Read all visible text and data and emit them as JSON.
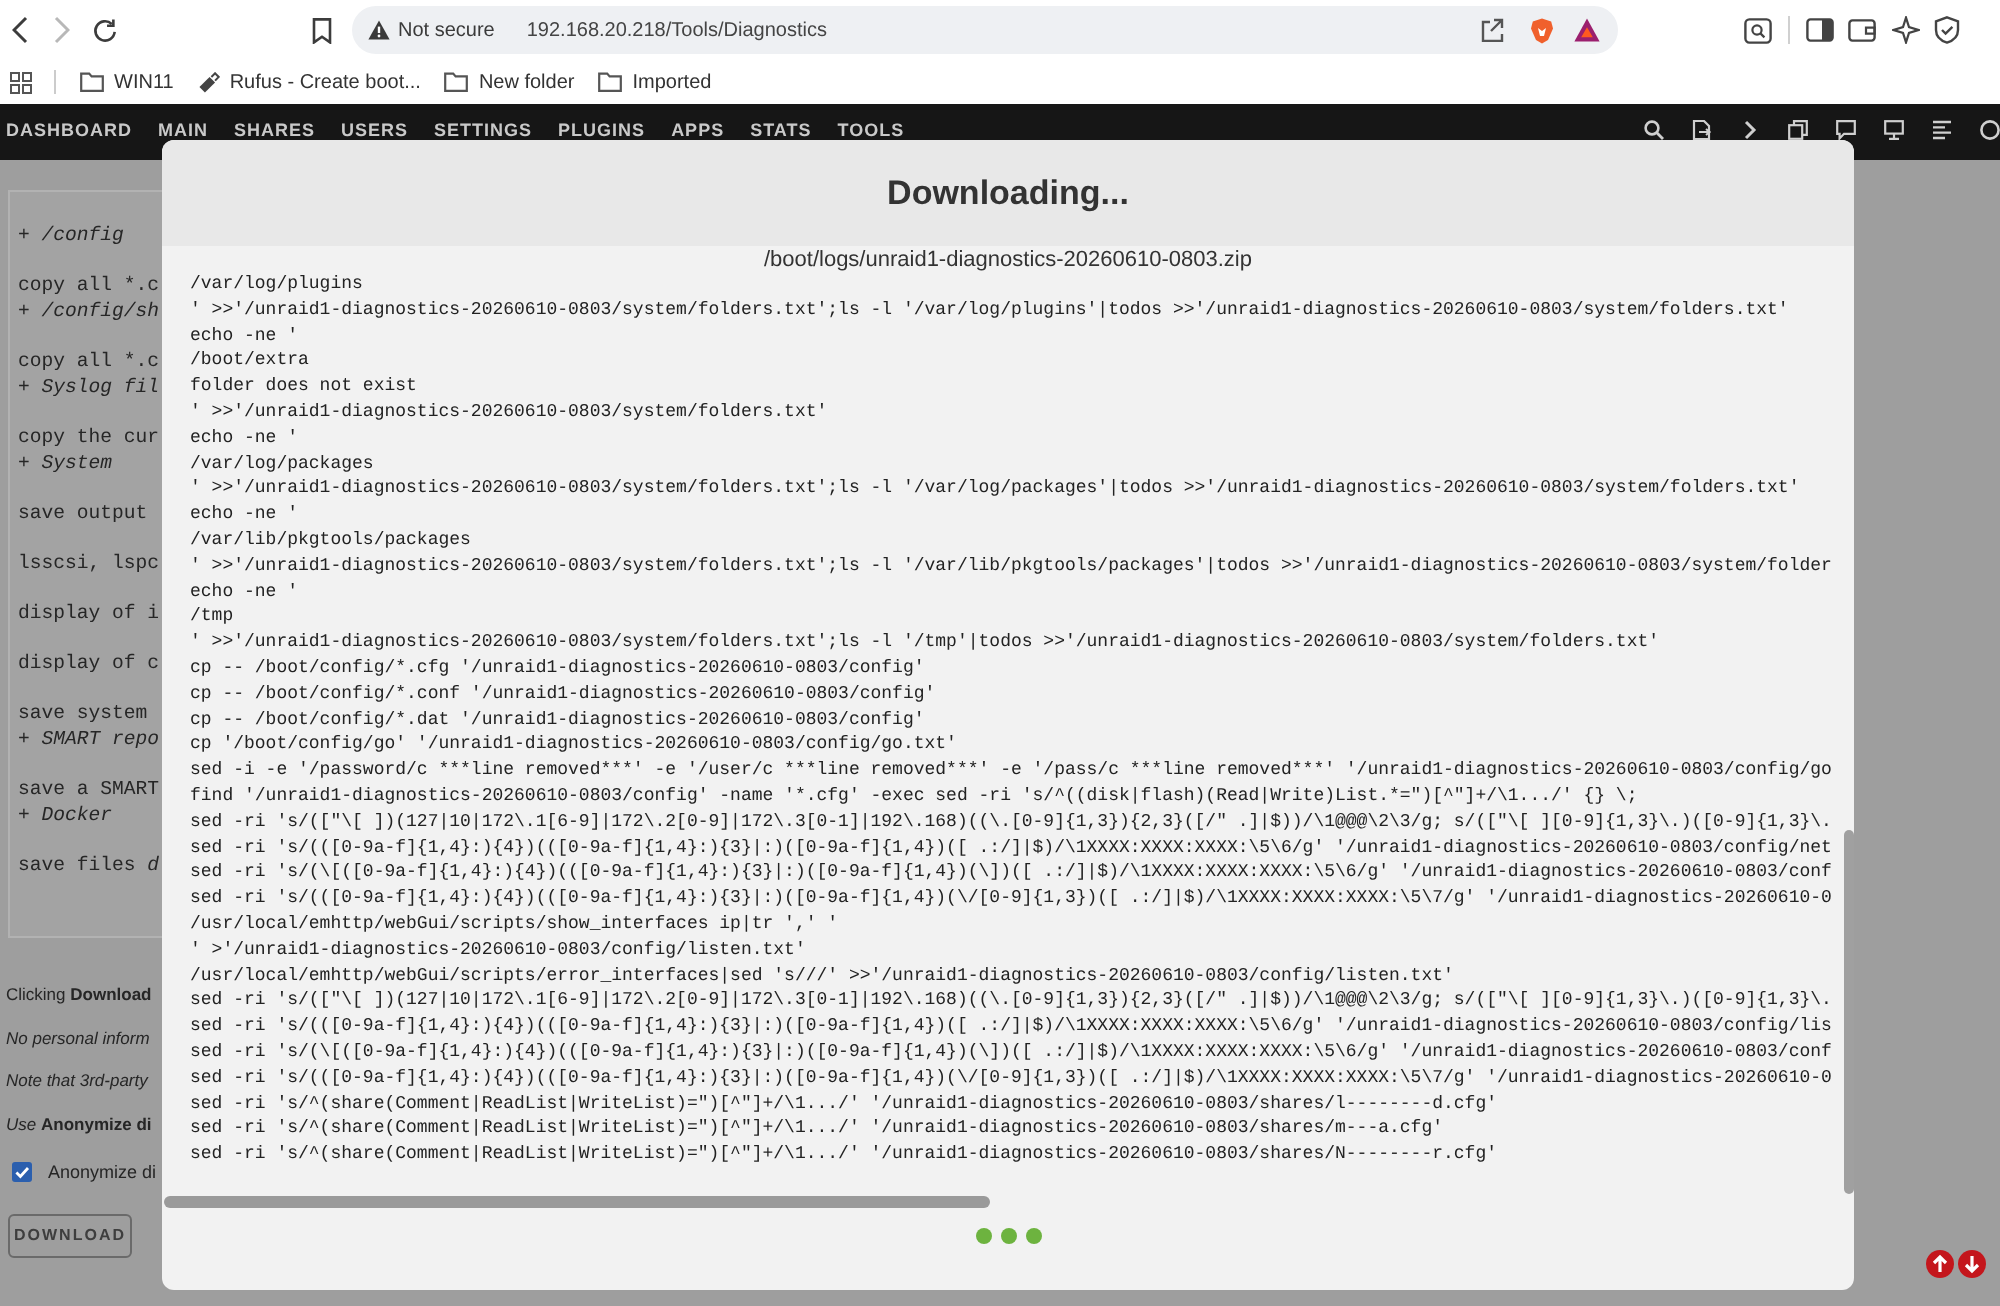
{
  "browser": {
    "address_bar": {
      "security_label": "Not secure",
      "url": "192.168.20.218/Tools/Diagnostics"
    },
    "bookmarks": [
      {
        "label": "WIN11",
        "kind": "folder"
      },
      {
        "label": "Rufus - Create boot...",
        "kind": "link"
      },
      {
        "label": "New folder",
        "kind": "folder"
      },
      {
        "label": "Imported",
        "kind": "folder"
      }
    ]
  },
  "nav": {
    "items": [
      "DASHBOARD",
      "MAIN",
      "SHARES",
      "USERS",
      "SETTINGS",
      "PLUGINS",
      "APPS",
      "STATS",
      "TOOLS"
    ]
  },
  "page": {
    "log_blocks": [
      [
        {
          "text": "+ /config",
          "kind": "section"
        }
      ],
      [
        {
          "text": "copy all *.c",
          "kind": "plain"
        },
        {
          "text": "+ /config/sh",
          "kind": "section"
        }
      ],
      [
        {
          "text": "copy all *.c",
          "kind": "plain"
        },
        {
          "text": "+ Syslog fil",
          "kind": "section"
        }
      ],
      [
        {
          "text": "copy the cur",
          "kind": "plain"
        },
        {
          "text": "+ System",
          "kind": "section"
        }
      ],
      [
        {
          "text": "save output",
          "kind": "plain"
        }
      ],
      [
        {
          "text": "lsscsi, lspc",
          "kind": "plain"
        }
      ],
      [
        {
          "text": "display of i",
          "kind": "plain"
        }
      ],
      [
        {
          "text": "display of c",
          "kind": "plain"
        }
      ],
      [
        {
          "text": "save system",
          "kind": "plain"
        },
        {
          "text": "+ SMART repo",
          "kind": "section"
        }
      ],
      [
        {
          "text": "save a SMART",
          "kind": "plain"
        },
        {
          "text": "+ Docker",
          "kind": "section"
        }
      ],
      [
        {
          "text": "save files *d*",
          "kind": "plain"
        }
      ]
    ],
    "notes": [
      {
        "text": "Clicking **Download**",
        "kind": "plain"
      },
      {
        "text": "No personal inform",
        "kind": "italic"
      },
      {
        "text": "Note that 3rd-party",
        "kind": "italic"
      },
      {
        "text": "*Use* **Anonymize di**",
        "kind": "plain"
      }
    ],
    "anonymize": {
      "label": "Anonymize di",
      "checked": true
    },
    "download_button": {
      "label": "DOWNLOAD",
      "disabled": true
    }
  },
  "dialog": {
    "title": "Downloading...",
    "file": "/boot/logs/unraid1-diagnostics-20260610-0803.zip",
    "log_lines": [
      "/var/log/plugins",
      "' >>'/unraid1-diagnostics-20260610-0803/system/folders.txt';ls -l '/var/log/plugins'|todos >>'/unraid1-diagnostics-20260610-0803/system/folders.txt'",
      "echo -ne '",
      "/boot/extra",
      "folder does not exist",
      "' >>'/unraid1-diagnostics-20260610-0803/system/folders.txt'",
      "echo -ne '",
      "/var/log/packages",
      "' >>'/unraid1-diagnostics-20260610-0803/system/folders.txt';ls -l '/var/log/packages'|todos >>'/unraid1-diagnostics-20260610-0803/system/folders.txt'",
      "echo -ne '",
      "/var/lib/pkgtools/packages",
      "' >>'/unraid1-diagnostics-20260610-0803/system/folders.txt';ls -l '/var/lib/pkgtools/packages'|todos >>'/unraid1-diagnostics-20260610-0803/system/folder",
      "echo -ne '",
      "/tmp",
      "' >>'/unraid1-diagnostics-20260610-0803/system/folders.txt';ls -l '/tmp'|todos >>'/unraid1-diagnostics-20260610-0803/system/folders.txt'",
      "cp -- /boot/config/*.cfg '/unraid1-diagnostics-20260610-0803/config'",
      "cp -- /boot/config/*.conf '/unraid1-diagnostics-20260610-0803/config'",
      "cp -- /boot/config/*.dat '/unraid1-diagnostics-20260610-0803/config'",
      "cp '/boot/config/go' '/unraid1-diagnostics-20260610-0803/config/go.txt'",
      "sed -i -e '/password/c ***line removed***' -e '/user/c ***line removed***' -e '/pass/c ***line removed***' '/unraid1-diagnostics-20260610-0803/config/go",
      "find '/unraid1-diagnostics-20260610-0803/config' -name '*.cfg' -exec sed -ri 's/^((disk|flash)(Read|Write)List.*=\")[^\"]+/\\1.../' {} \\;",
      "sed -ri 's/([\"\\[ ])(127|10|172\\.1[6-9]|172\\.2[0-9]|172\\.3[0-1]|192\\.168)((\\.[0-9]{1,3}){2,3}([/\" .]|$))/\\1@@@\\2\\3/g; s/([\"\\[ ][0-9]{1,3}\\.)([0-9]{1,3}\\.",
      "sed -ri 's/(([0-9a-f]{1,4}:){4})(([0-9a-f]{1,4}:){3}|:)([0-9a-f]{1,4})([ .:/]|$)/\\1XXXX:XXXX:XXXX:\\5\\6/g' '/unraid1-diagnostics-20260610-0803/config/net",
      "sed -ri 's/(\\[([0-9a-f]{1,4}:){4})(([0-9a-f]{1,4}:){3}|:)([0-9a-f]{1,4})(\\])([ .:/]|$)/\\1XXXX:XXXX:XXXX:\\5\\6/g' '/unraid1-diagnostics-20260610-0803/conf",
      "sed -ri 's/(([0-9a-f]{1,4}:){4})(([0-9a-f]{1,4}:){3}|:)([0-9a-f]{1,4})(\\/[0-9]{1,3})([ .:/]|$)/\\1XXXX:XXXX:XXXX:\\5\\7/g' '/unraid1-diagnostics-20260610-0",
      "/usr/local/emhttp/webGui/scripts/show_interfaces ip|tr ',' '",
      "' >'/unraid1-diagnostics-20260610-0803/config/listen.txt'",
      "/usr/local/emhttp/webGui/scripts/error_interfaces|sed 's///' >>'/unraid1-diagnostics-20260610-0803/config/listen.txt'",
      "sed -ri 's/([\"\\[ ])(127|10|172\\.1[6-9]|172\\.2[0-9]|172\\.3[0-1]|192\\.168)((\\.[0-9]{1,3}){2,3}([/\" .]|$))/\\1@@@\\2\\3/g; s/([\"\\[ ][0-9]{1,3}\\.)([0-9]{1,3}\\.",
      "sed -ri 's/(([0-9a-f]{1,4}:){4})(([0-9a-f]{1,4}:){3}|:)([0-9a-f]{1,4})([ .:/]|$)/\\1XXXX:XXXX:XXXX:\\5\\6/g' '/unraid1-diagnostics-20260610-0803/config/lis",
      "sed -ri 's/(\\[([0-9a-f]{1,4}:){4})(([0-9a-f]{1,4}:){3}|:)([0-9a-f]{1,4})(\\])([ .:/]|$)/\\1XXXX:XXXX:XXXX:\\5\\6/g' '/unraid1-diagnostics-20260610-0803/conf",
      "sed -ri 's/(([0-9a-f]{1,4}:){4})(([0-9a-f]{1,4}:){3}|:)([0-9a-f]{1,4})(\\/[0-9]{1,3})([ .:/]|$)/\\1XXXX:XXXX:XXXX:\\5\\7/g' '/unraid1-diagnostics-20260610-0",
      "sed -ri 's/^(share(Comment|ReadList|WriteList)=\")[^\"]+/\\1.../' '/unraid1-diagnostics-20260610-0803/shares/l--------d.cfg'",
      "sed -ri 's/^(share(Comment|ReadList|WriteList)=\")[^\"]+/\\1.../' '/unraid1-diagnostics-20260610-0803/shares/m---a.cfg'",
      "sed -ri 's/^(share(Comment|ReadList|WriteList)=\")[^\"]+/\\1.../' '/unraid1-diagnostics-20260610-0803/shares/N--------r.cfg'"
    ]
  }
}
